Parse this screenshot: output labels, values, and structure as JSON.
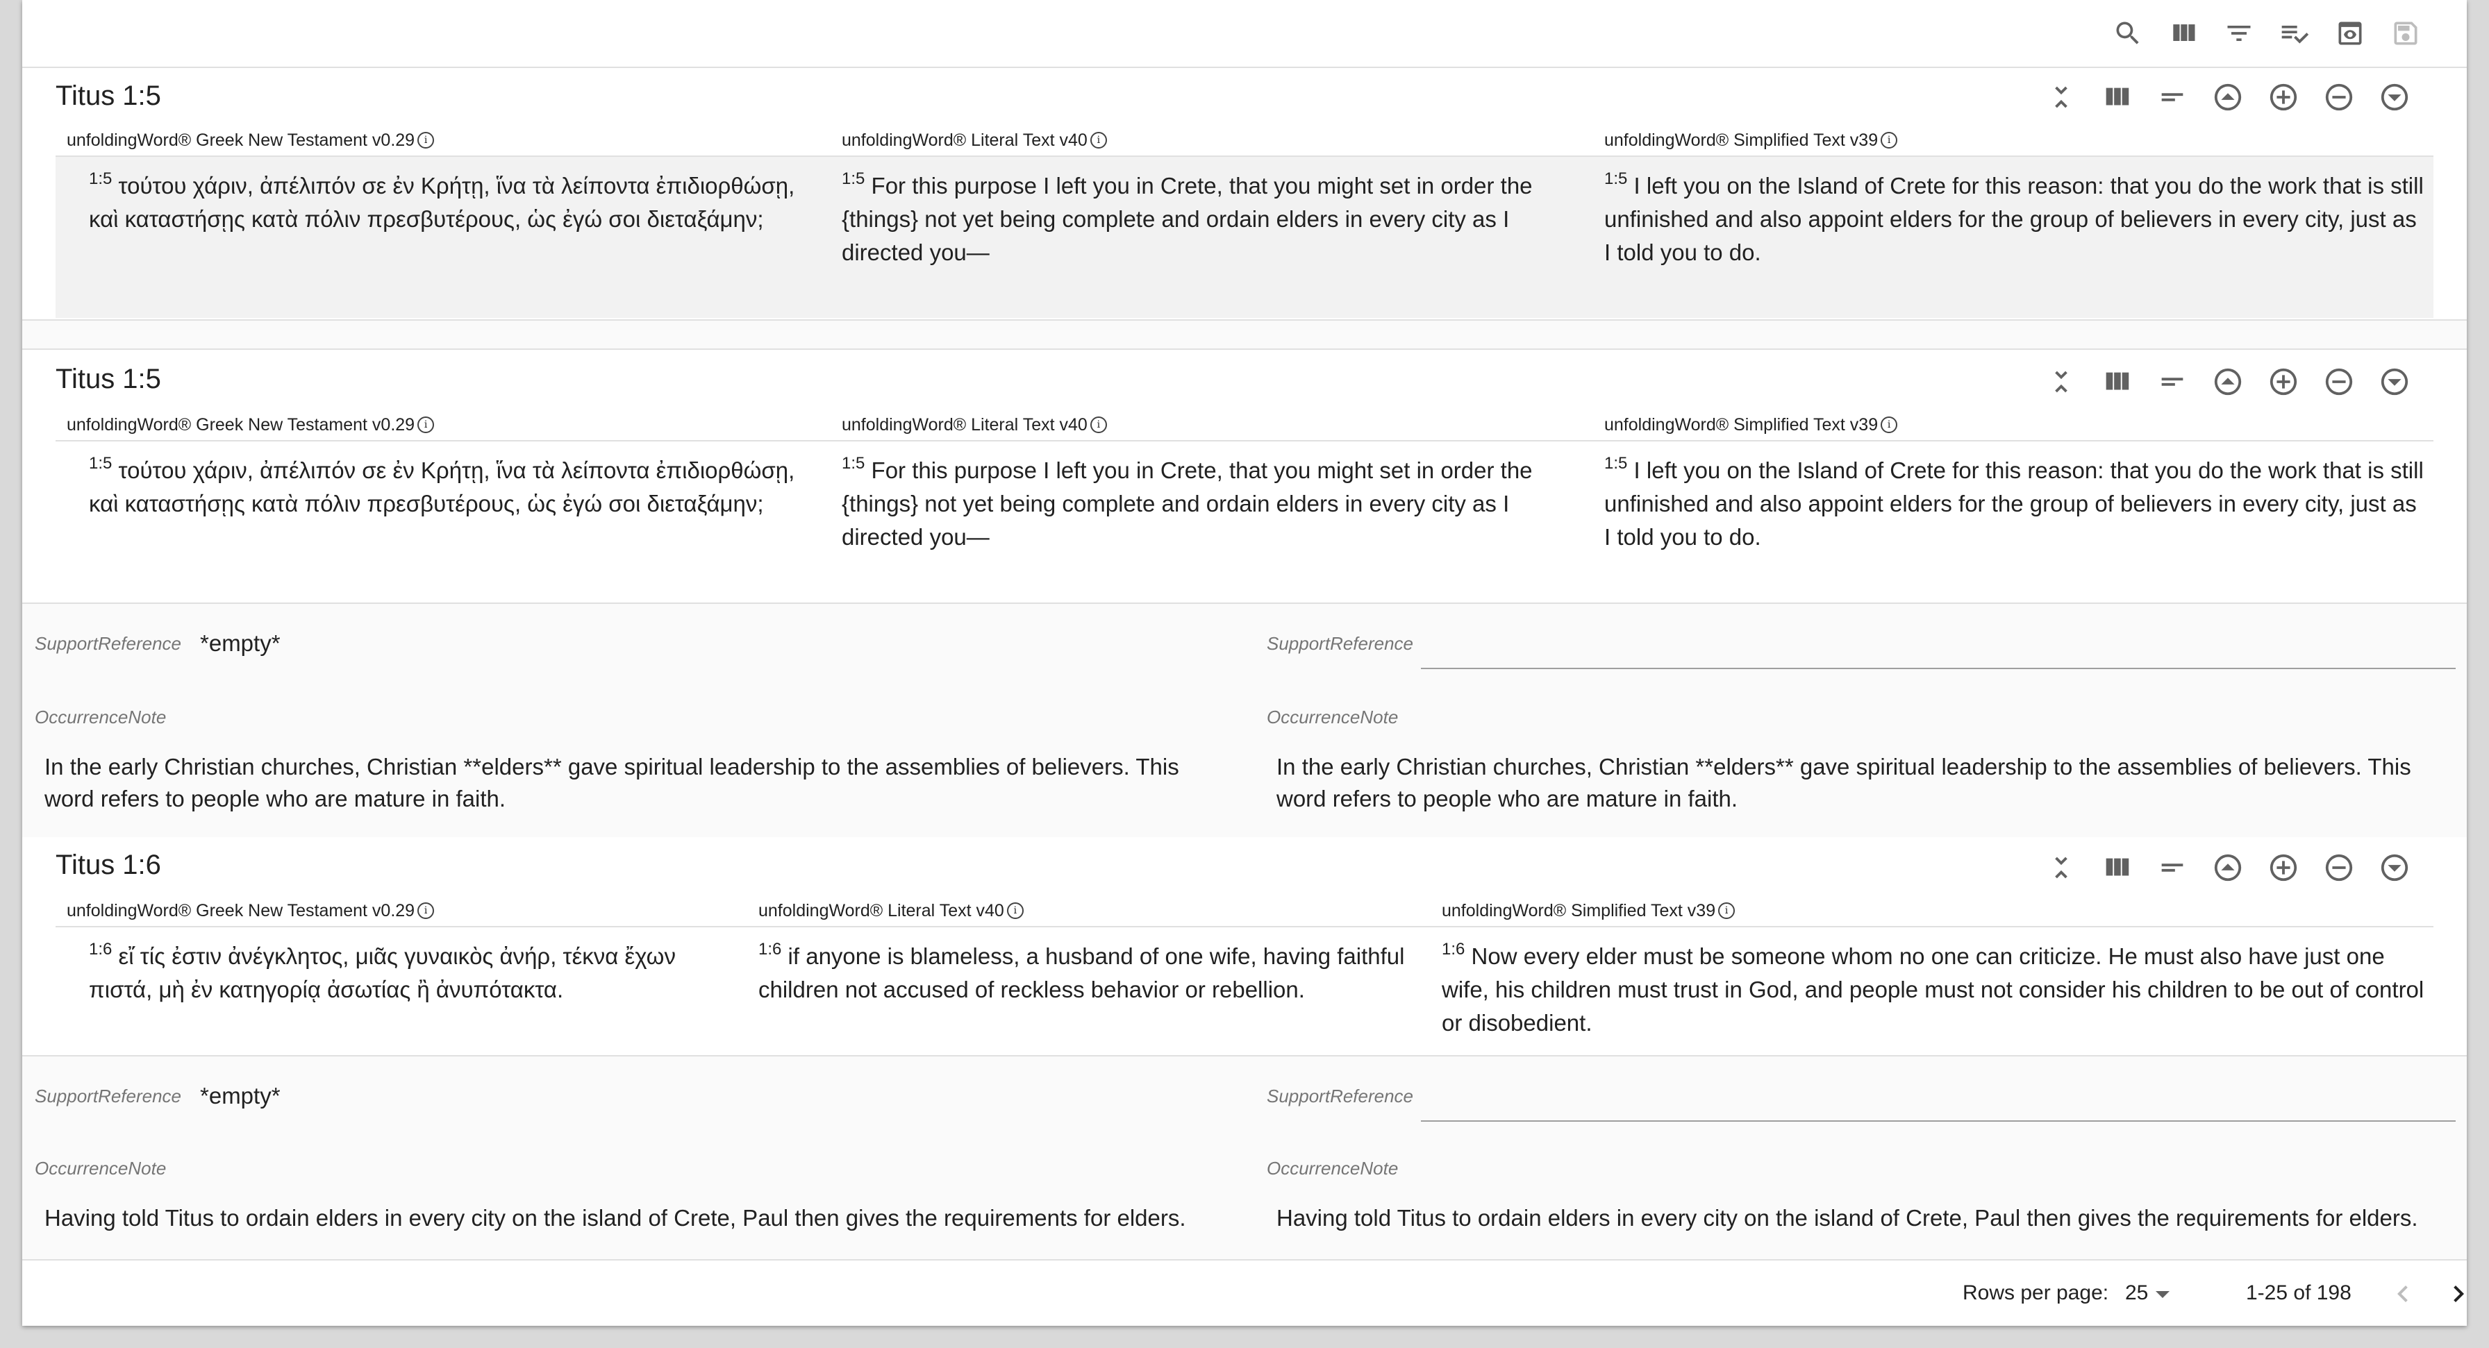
{
  "toolbar": {
    "icons": [
      "search-icon",
      "view-column-icon",
      "filter-icon",
      "playlist-check-icon",
      "preview-icon",
      "save-icon"
    ]
  },
  "pane_icons": [
    "collapse-icon",
    "columns-icon",
    "subject-icon",
    "arrow-up-circle-icon",
    "add-circle-icon",
    "remove-circle-icon",
    "arrow-down-circle-icon"
  ],
  "rows": [
    {
      "title": "Titus 1:5",
      "resources": [
        {
          "header": "unfoldingWord® Greek New Testament v0.29",
          "ref": "1:5",
          "text": "τούτου χάριν, ἀπέλιπόν σε ἐν Κρήτῃ, ἵνα τὰ λείποντα ἐπιδιορθώσῃ, καὶ καταστήσῃς κατὰ πόλιν πρεσβυτέρους, ὡς ἐγώ σοι διεταξάμην;"
        },
        {
          "header": "unfoldingWord® Literal Text v40",
          "ref": "1:5",
          "text": "For this purpose I left you in Crete, that you might set in order the {things} not yet being complete and ordain elders in every city as I directed you—"
        },
        {
          "header": "unfoldingWord® Simplified Text v39",
          "ref": "1:5",
          "text": "I left you on the Island of Crete for this reason: that you do the work that is still unfinished and also appoint elders for the group of believers in every city, just as I told you to do."
        }
      ]
    },
    {
      "title": "Titus 1:5",
      "resources": [
        {
          "header": "unfoldingWord® Greek New Testament v0.29",
          "ref": "1:5",
          "text": "τούτου χάριν, ἀπέλιπόν σε ἐν Κρήτῃ, ἵνα τὰ λείποντα ἐπιδιορθώσῃ, καὶ καταστήσῃς κατὰ πόλιν πρεσβυτέρους, ὡς ἐγώ σοι διεταξάμην;"
        },
        {
          "header": "unfoldingWord® Literal Text v40",
          "ref": "1:5",
          "text": "For this purpose I left you in Crete, that you might set in order the {things} not yet being complete and ordain elders in every city as I directed you—"
        },
        {
          "header": "unfoldingWord® Simplified Text v39",
          "ref": "1:5",
          "text": "I left you on the Island of Crete for this reason: that you do the work that is still unfinished and also appoint elders for the group of believers in every city, just as I told you to do."
        }
      ],
      "notes": {
        "support_label": "SupportReference",
        "support_value_left": "*empty*",
        "occurrence_label": "OccurrenceNote",
        "occurrence_left": "In the early Christian churches, Christian **elders** gave spiritual leadership to the assemblies of believers. This word refers to people who are mature in faith.",
        "occurrence_right": "In the early Christian churches, Christian **elders** gave spiritual leadership to the assemblies of believers. This word refers to people who are mature in faith."
      }
    },
    {
      "title": "Titus 1:6",
      "resources": [
        {
          "header": "unfoldingWord® Greek New Testament v0.29",
          "ref": "1:6",
          "text": "εἴ τίς ἐστιν ἀνέγκλητος, μιᾶς γυναικὸς ἀνήρ, τέκνα ἔχων πιστά, μὴ ἐν κατηγορίᾳ ἀσωτίας ἢ ἀνυπότακτα."
        },
        {
          "header": "unfoldingWord® Literal Text v40",
          "ref": "1:6",
          "text": "if anyone is blameless, a husband of one wife, having faithful children not accused of reckless behavior or rebellion."
        },
        {
          "header": "unfoldingWord® Simplified Text v39",
          "ref": "1:6",
          "text": "Now every elder must be someone whom no one can criticize. He must also have just one wife, his children must trust in God, and people must not consider his children to be out of control or disobedient."
        }
      ],
      "notes": {
        "support_label": "SupportReference",
        "support_value_left": "*empty*",
        "occurrence_label": "OccurrenceNote",
        "occurrence_left": "Having told Titus to ordain elders in every city on the island of Crete, Paul then gives the requirements for elders.",
        "occurrence_right": "Having told Titus to ordain elders in every city on the island of Crete, Paul then gives the requirements for elders."
      }
    }
  ],
  "footer": {
    "rows_per_page_label": "Rows per page:",
    "rows_per_page_value": "25",
    "range": "1-25 of 198"
  }
}
